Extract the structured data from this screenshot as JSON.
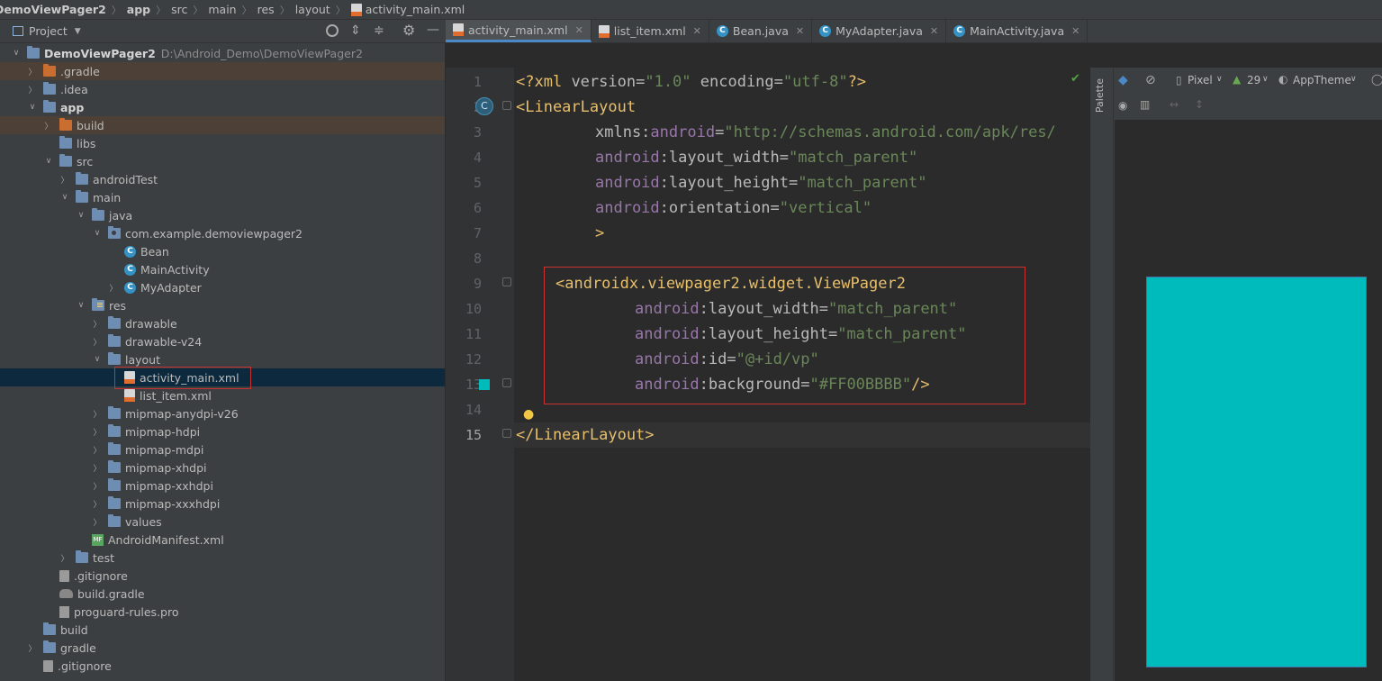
{
  "breadcrumb": [
    "DemoViewPager2",
    "app",
    "src",
    "main",
    "res",
    "layout",
    "activity_main.xml"
  ],
  "project_panel": {
    "title": "Project"
  },
  "tree": [
    {
      "label": "DemoViewPager2",
      "hint": "D:\\Android_Demo\\DemoViewPager2",
      "depth": 0,
      "expanded": true,
      "icon": "folder",
      "bold": true
    },
    {
      "label": ".gradle",
      "depth": 1,
      "expanded": false,
      "icon": "folder-orange",
      "excluded": true
    },
    {
      "label": ".idea",
      "depth": 1,
      "expanded": false,
      "icon": "folder"
    },
    {
      "label": "app",
      "depth": 1,
      "expanded": true,
      "icon": "folder",
      "bold": true
    },
    {
      "label": "build",
      "depth": 2,
      "expanded": false,
      "icon": "folder-orange",
      "excluded": true
    },
    {
      "label": "libs",
      "depth": 2,
      "icon": "folder"
    },
    {
      "label": "src",
      "depth": 2,
      "expanded": true,
      "icon": "folder"
    },
    {
      "label": "androidTest",
      "depth": 3,
      "expanded": false,
      "icon": "folder"
    },
    {
      "label": "main",
      "depth": 3,
      "expanded": true,
      "icon": "folder"
    },
    {
      "label": "java",
      "depth": 4,
      "expanded": true,
      "icon": "folder"
    },
    {
      "label": "com.example.demoviewpager2",
      "depth": 5,
      "expanded": true,
      "icon": "package"
    },
    {
      "label": "Bean",
      "depth": 6,
      "icon": "class"
    },
    {
      "label": "MainActivity",
      "depth": 6,
      "icon": "class"
    },
    {
      "label": "MyAdapter",
      "depth": 6,
      "expanded": false,
      "icon": "class"
    },
    {
      "label": "res",
      "depth": 4,
      "expanded": true,
      "icon": "res"
    },
    {
      "label": "drawable",
      "depth": 5,
      "expanded": false,
      "icon": "folder"
    },
    {
      "label": "drawable-v24",
      "depth": 5,
      "expanded": false,
      "icon": "folder"
    },
    {
      "label": "layout",
      "depth": 5,
      "expanded": true,
      "icon": "folder"
    },
    {
      "label": "activity_main.xml",
      "depth": 6,
      "icon": "xml",
      "selected": true,
      "boxed": true
    },
    {
      "label": "list_item.xml",
      "depth": 6,
      "icon": "xml"
    },
    {
      "label": "mipmap-anydpi-v26",
      "depth": 5,
      "expanded": false,
      "icon": "folder"
    },
    {
      "label": "mipmap-hdpi",
      "depth": 5,
      "expanded": false,
      "icon": "folder"
    },
    {
      "label": "mipmap-mdpi",
      "depth": 5,
      "expanded": false,
      "icon": "folder"
    },
    {
      "label": "mipmap-xhdpi",
      "depth": 5,
      "expanded": false,
      "icon": "folder"
    },
    {
      "label": "mipmap-xxhdpi",
      "depth": 5,
      "expanded": false,
      "icon": "folder"
    },
    {
      "label": "mipmap-xxxhdpi",
      "depth": 5,
      "expanded": false,
      "icon": "folder"
    },
    {
      "label": "values",
      "depth": 5,
      "expanded": false,
      "icon": "folder"
    },
    {
      "label": "AndroidManifest.xml",
      "depth": 4,
      "icon": "manifest"
    },
    {
      "label": "test",
      "depth": 3,
      "expanded": false,
      "icon": "folder"
    },
    {
      "label": ".gitignore",
      "depth": 2,
      "icon": "git"
    },
    {
      "label": "build.gradle",
      "depth": 2,
      "icon": "gradle"
    },
    {
      "label": "proguard-rules.pro",
      "depth": 2,
      "icon": "text"
    },
    {
      "label": "build",
      "depth": 1,
      "icon": "folder"
    },
    {
      "label": "gradle",
      "depth": 1,
      "expanded": false,
      "icon": "folder"
    },
    {
      "label": ".gitignore",
      "depth": 1,
      "icon": "git"
    }
  ],
  "tabs": [
    {
      "label": "activity_main.xml",
      "icon": "xml",
      "active": true
    },
    {
      "label": "list_item.xml",
      "icon": "xml"
    },
    {
      "label": "Bean.java",
      "icon": "class"
    },
    {
      "label": "MyAdapter.java",
      "icon": "class"
    },
    {
      "label": "MainActivity.java",
      "icon": "class"
    }
  ],
  "code_lines": [
    {
      "n": "1",
      "indent": 0,
      "parts": [
        [
          "brk",
          "<?"
        ],
        [
          "tagc",
          "xml "
        ],
        [
          "attr",
          "version"
        ],
        [
          "attr",
          "="
        ],
        [
          "str",
          "\"1.0\""
        ],
        [
          "attr",
          " encoding"
        ],
        [
          "attr",
          "="
        ],
        [
          "str",
          "\"utf-8\""
        ],
        [
          "brk",
          "?>"
        ]
      ]
    },
    {
      "n": "2",
      "indent": 0,
      "parts": [
        [
          "tagc",
          "<LinearLayout"
        ]
      ]
    },
    {
      "n": "3",
      "indent": 8,
      "parts": [
        [
          "attr",
          "xmlns:"
        ],
        [
          "ns",
          "android"
        ],
        [
          "attr",
          "="
        ],
        [
          "str",
          "\"http://schemas.android.com/apk/res/"
        ]
      ]
    },
    {
      "n": "4",
      "indent": 8,
      "parts": [
        [
          "ns",
          "android"
        ],
        [
          "attr",
          ":layout_width"
        ],
        [
          "attr",
          "="
        ],
        [
          "str",
          "\"match_parent\""
        ]
      ]
    },
    {
      "n": "5",
      "indent": 8,
      "parts": [
        [
          "ns",
          "android"
        ],
        [
          "attr",
          ":layout_height"
        ],
        [
          "attr",
          "="
        ],
        [
          "str",
          "\"match_parent\""
        ]
      ]
    },
    {
      "n": "6",
      "indent": 8,
      "parts": [
        [
          "ns",
          "android"
        ],
        [
          "attr",
          ":orientation"
        ],
        [
          "attr",
          "="
        ],
        [
          "str",
          "\"vertical\""
        ]
      ]
    },
    {
      "n": "7",
      "indent": 8,
      "parts": [
        [
          "tagc",
          ">"
        ]
      ]
    },
    {
      "n": "8",
      "indent": 0,
      "parts": []
    },
    {
      "n": "9",
      "indent": 4,
      "parts": [
        [
          "tagc",
          "<androidx.viewpager2.widget.ViewPager2"
        ]
      ]
    },
    {
      "n": "10",
      "indent": 12,
      "parts": [
        [
          "ns",
          "android"
        ],
        [
          "attr",
          ":layout_width"
        ],
        [
          "attr",
          "="
        ],
        [
          "str",
          "\"match_parent\""
        ]
      ]
    },
    {
      "n": "11",
      "indent": 12,
      "parts": [
        [
          "ns",
          "android"
        ],
        [
          "attr",
          ":layout_height"
        ],
        [
          "attr",
          "="
        ],
        [
          "str",
          "\"match_parent\""
        ]
      ]
    },
    {
      "n": "12",
      "indent": 12,
      "parts": [
        [
          "ns",
          "android"
        ],
        [
          "attr",
          ":id"
        ],
        [
          "attr",
          "="
        ],
        [
          "str",
          "\"@+id/vp\""
        ]
      ]
    },
    {
      "n": "13",
      "indent": 12,
      "parts": [
        [
          "ns",
          "android"
        ],
        [
          "attr",
          ":background"
        ],
        [
          "attr",
          "="
        ],
        [
          "str",
          "\"#FF00BBBB\""
        ],
        [
          "tagc",
          "/>"
        ]
      ]
    },
    {
      "n": "14",
      "indent": 0,
      "parts": []
    },
    {
      "n": "15",
      "indent": 0,
      "parts": [
        [
          "tagc",
          "</LinearLayout>"
        ]
      ]
    }
  ],
  "preview_toolbar": {
    "device": "Pixel",
    "api": "29",
    "theme": "AppTheme",
    "palette": "Palette"
  },
  "colors": {
    "viewpager_background": "#00BBBB",
    "highlight_box": "#C83232",
    "accent": "#4A88C7"
  }
}
